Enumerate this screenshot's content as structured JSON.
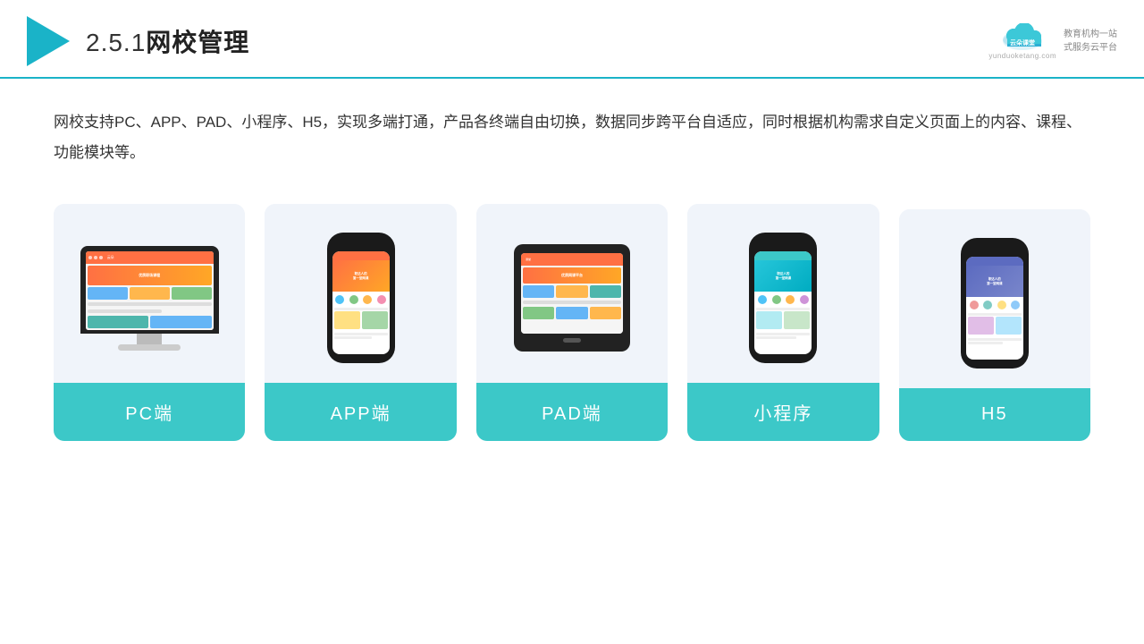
{
  "header": {
    "section_number": "2.5.1",
    "title": "网校管理",
    "brand_name_cn": "云朵课堂",
    "brand_name_en": "yunduoketang.com",
    "brand_tagline": "教育机构一站\n式服务云平台"
  },
  "description": "网校支持PC、APP、PAD、小程序、H5，实现多端打通，产品各终端自由切换，数据同步跨平台自适应，同时根据机构需求自定义页面上的内容、课程、功能模块等。",
  "cards": [
    {
      "id": "pc",
      "label": "PC端",
      "type": "pc"
    },
    {
      "id": "app",
      "label": "APP端",
      "type": "phone"
    },
    {
      "id": "pad",
      "label": "PAD端",
      "type": "tablet"
    },
    {
      "id": "miniprogram",
      "label": "小程序",
      "type": "phone"
    },
    {
      "id": "h5",
      "label": "H5",
      "type": "phone"
    }
  ]
}
